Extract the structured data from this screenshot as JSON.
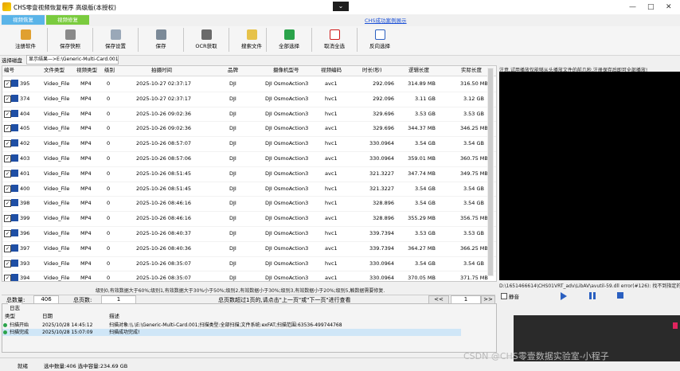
{
  "window": {
    "title": "CHS零壹视频恢复程序 高级版(本授权)",
    "collapse_glyph": "⌄",
    "minimize": "—",
    "maximize": "□",
    "close": "✕"
  },
  "header_link": "CHS成功案例展示",
  "tabs": [
    {
      "label": "视频恢复"
    },
    {
      "label": "视频修复"
    }
  ],
  "toolbar": [
    {
      "label": "注册软件",
      "icon": "register-icon",
      "color": "#e0a030"
    },
    {
      "label": "保存快照",
      "icon": "snapshot-icon",
      "color": "#8a8a8a"
    },
    {
      "label": "保存设置",
      "icon": "settings-icon",
      "color": "#9aa8b8"
    },
    {
      "label": "保存",
      "icon": "save-icon",
      "color": "#7c8a98"
    },
    {
      "label": "OCR获取",
      "icon": "ocr-icon",
      "color": "#6a6a6a"
    },
    {
      "label": "搜索文件",
      "icon": "search-file-icon",
      "color": "#e6c24a"
    },
    {
      "label": "全部选择",
      "icon": "check-icon",
      "color": "#2aa34a"
    },
    {
      "label": "取消全选",
      "icon": "cancel-icon",
      "color": "#d01a1a"
    },
    {
      "label": "反向选择",
      "icon": "invert-icon",
      "color": "#2a5fc0"
    }
  ],
  "panel": {
    "label": "选择磁盘",
    "path": "显示结果—>E:\\Generic-Multi-Card.001"
  },
  "table": {
    "columns": [
      "编号",
      "文件类型",
      "视频类型",
      "级别",
      "拍摄时间",
      "品牌",
      "摄像机型号",
      "视频编码",
      "时长(秒)",
      "逻辑长度",
      "实际长度"
    ],
    "rows": [
      [
        "395",
        "Video_File",
        "MP4",
        "0",
        "2025-10-27 02:37:17",
        "DJI",
        "DJI OsmoAction3",
        "avc1",
        "292.096",
        "314.89 MB",
        "316.50 MB"
      ],
      [
        "374",
        "Video_File",
        "MP4",
        "0",
        "2025-10-27 02:37:17",
        "DJI",
        "DJI OsmoAction3",
        "hvc1",
        "292.096",
        "3.11 GB",
        "3.12 GB"
      ],
      [
        "404",
        "Video_File",
        "MP4",
        "0",
        "2025-10-26 09:02:36",
        "DJI",
        "DJI OsmoAction3",
        "hvc1",
        "329.696",
        "3.53 GB",
        "3.53 GB"
      ],
      [
        "405",
        "Video_File",
        "MP4",
        "0",
        "2025-10-26 09:02:36",
        "DJI",
        "DJI OsmoAction3",
        "avc1",
        "329.696",
        "344.37 MB",
        "346.25 MB"
      ],
      [
        "402",
        "Video_File",
        "MP4",
        "0",
        "2025-10-26 08:57:07",
        "DJI",
        "DJI OsmoAction3",
        "hvc1",
        "330.0964",
        "3.54 GB",
        "3.54 GB"
      ],
      [
        "403",
        "Video_File",
        "MP4",
        "0",
        "2025-10-26 08:57:06",
        "DJI",
        "DJI OsmoAction3",
        "avc1",
        "330.0964",
        "359.01 MB",
        "360.75 MB"
      ],
      [
        "401",
        "Video_File",
        "MP4",
        "0",
        "2025-10-26 08:51:45",
        "DJI",
        "DJI OsmoAction3",
        "avc1",
        "321.3227",
        "347.74 MB",
        "349.75 MB"
      ],
      [
        "400",
        "Video_File",
        "MP4",
        "0",
        "2025-10-26 08:51:45",
        "DJI",
        "DJI OsmoAction3",
        "hvc1",
        "321.3227",
        "3.54 GB",
        "3.54 GB"
      ],
      [
        "398",
        "Video_File",
        "MP4",
        "0",
        "2025-10-26 08:46:16",
        "DJI",
        "DJI OsmoAction3",
        "hvc1",
        "328.896",
        "3.54 GB",
        "3.54 GB"
      ],
      [
        "399",
        "Video_File",
        "MP4",
        "0",
        "2025-10-26 08:46:16",
        "DJI",
        "DJI OsmoAction3",
        "avc1",
        "328.896",
        "355.29 MB",
        "356.75 MB"
      ],
      [
        "396",
        "Video_File",
        "MP4",
        "0",
        "2025-10-26 08:40:37",
        "DJI",
        "DJI OsmoAction3",
        "hvc1",
        "339.7394",
        "3.53 GB",
        "3.53 GB"
      ],
      [
        "397",
        "Video_File",
        "MP4",
        "0",
        "2025-10-26 08:40:36",
        "DJI",
        "DJI OsmoAction3",
        "avc1",
        "339.7394",
        "364.27 MB",
        "366.25 MB"
      ],
      [
        "393",
        "Video_File",
        "MP4",
        "0",
        "2025-10-26 08:35:07",
        "DJI",
        "DJI OsmoAction3",
        "hvc1",
        "330.0964",
        "3.54 GB",
        "3.54 GB"
      ],
      [
        "394",
        "Video_File",
        "MP4",
        "0",
        "2025-10-26 08:35:07",
        "DJI",
        "DJI OsmoAction3",
        "avc1",
        "330.0964",
        "370.05 MB",
        "371.75 MB"
      ]
    ]
  },
  "filter_note": "级别0,有效数据大于60%;级别1,有效数据大于30%小于50%;级别2,有效数据小于30%;级别3,有效数据小于20%;级别5,触数据需要修复.",
  "pager": {
    "total_label": "总数量:",
    "total": "406",
    "pages_label": "总页数:",
    "pages": "1",
    "hint": "总页数超过1页的,请点击\"上一页\"或\"下一页\"进行查看",
    "prev": "<<",
    "current": "1",
    "next": ">>"
  },
  "log": {
    "title": "日志",
    "columns": [
      "类型",
      "日期",
      "描述"
    ],
    "rows": [
      [
        "扫描开始",
        "2025/10/28 14:45:12",
        "扫描对象:\\\\.\\E:\\Generic-Multi-Card.001;扫描类型:全部扫描;文件系统:exFAT;扫描范围:63536-499744768"
      ],
      [
        "扫描完成",
        "2025/10/28 15:07:09",
        "扫描成功完成!"
      ]
    ]
  },
  "status": {
    "label": "就绪",
    "selected": "选中数量:406 选中容量:234.69 GB"
  },
  "preview": {
    "note": "注意,试用播放仅能够从头播放文件的前几秒,注册保存后即可全部播放!",
    "path": "D:\\1651466614\\CHS01VRT_adv\\LibAV\\avutil-59.dll error(#126): 找不到指定的模块",
    "mute_label": "静音"
  },
  "watermark": "CSDN @CHS零壹数据实验室-小程子",
  "colors": {
    "tab_bg": "#5ab4e8",
    "tab_active": "#7acb3e",
    "link": "#1a4fd6",
    "accent_red": "#e0245e"
  }
}
